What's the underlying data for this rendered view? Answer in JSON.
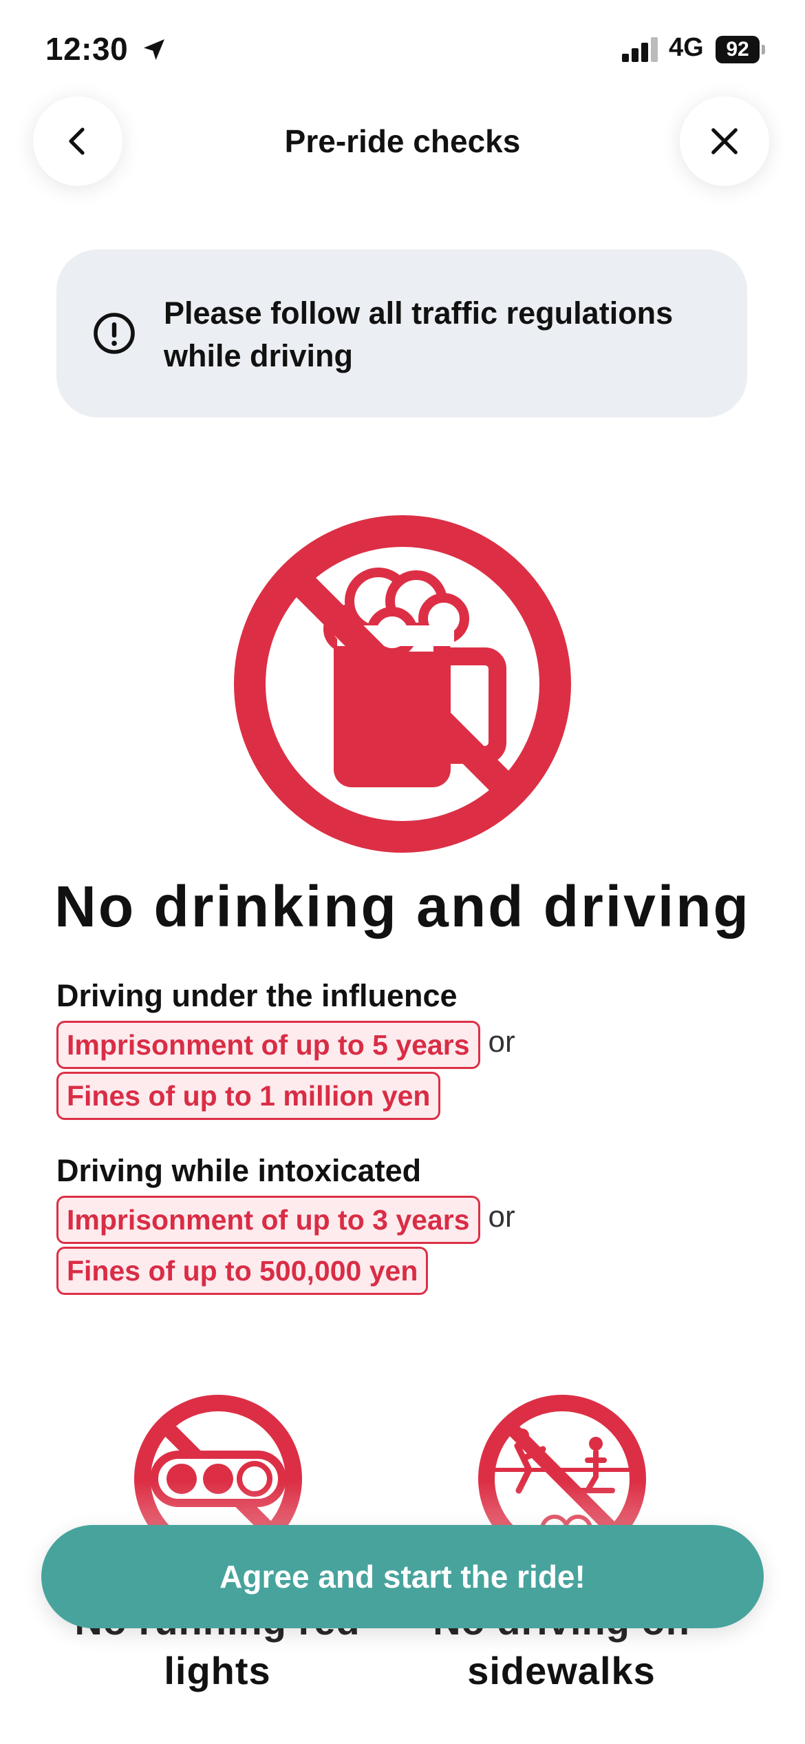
{
  "status_bar": {
    "time": "12:30",
    "network": "4G",
    "battery": "92"
  },
  "nav": {
    "title": "Pre-ride checks"
  },
  "notice": {
    "text": "Please follow all traffic regulations while driving"
  },
  "main_rule": {
    "heading": "No drinking and driving"
  },
  "penalties": [
    {
      "title": "Driving under the influence",
      "imprisonment": "Imprisonment of up to 5 years",
      "connector": "or",
      "fine": "Fines of up to 1 million yen"
    },
    {
      "title": "Driving while intoxicated",
      "imprisonment": "Imprisonment of up to 3 years",
      "connector": "or",
      "fine": "Fines of up to 500,000 yen"
    }
  ],
  "other_rules": [
    {
      "line1": "No running red",
      "line2": "lights",
      "icon": "no-red-light-icon"
    },
    {
      "line1": "No driving on",
      "line2": "sidewalks",
      "icon": "no-sidewalk-icon"
    }
  ],
  "cta": {
    "label": "Agree and start the ride!"
  },
  "colors": {
    "danger": "#dc2f45",
    "primary": "#48a39d",
    "notice_bg": "#ebeef2"
  }
}
